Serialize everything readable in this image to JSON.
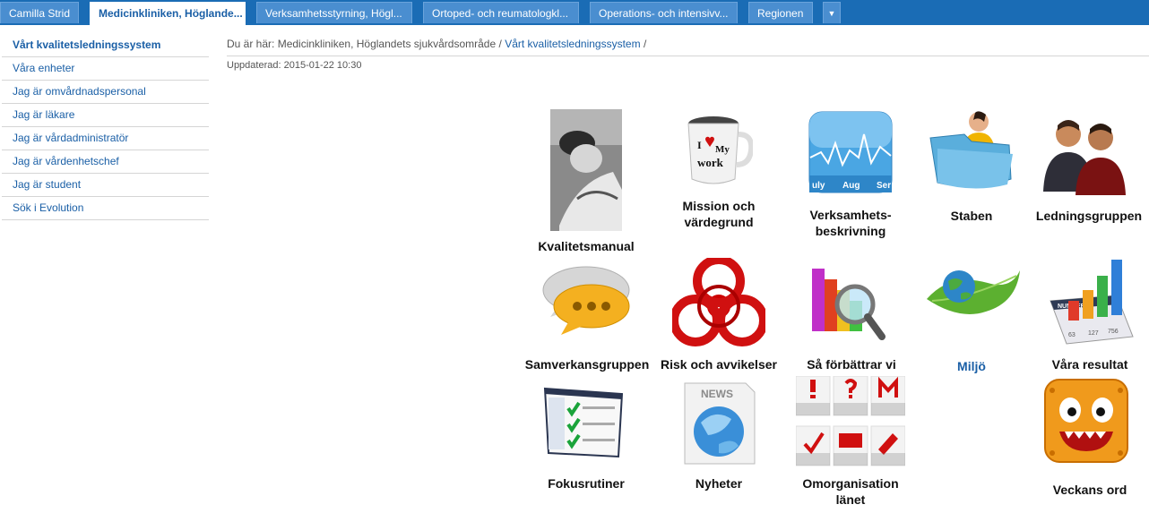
{
  "tabs": [
    {
      "label": "Camilla Strid"
    },
    {
      "label": "Medicinkliniken, Höglande..."
    },
    {
      "label": "Verksamhetsstyrning, Högl..."
    },
    {
      "label": "Ortoped- och reumatologkl..."
    },
    {
      "label": "Operations- och intensivv..."
    },
    {
      "label": "Regionen"
    }
  ],
  "sidebar": {
    "items": [
      {
        "label": "Vårt kvalitetsledningssystem"
      },
      {
        "label": "Våra enheter"
      },
      {
        "label": "Jag är omvårdnadspersonal"
      },
      {
        "label": "Jag är läkare"
      },
      {
        "label": "Jag är vårdadministratör"
      },
      {
        "label": "Jag är vårdenhetschef"
      },
      {
        "label": "Jag är student"
      },
      {
        "label": "Sök i Evolution"
      }
    ]
  },
  "breadcrumb": {
    "prefix": "Du är här:",
    "parent": "Medicinkliniken, Höglandets sjukvårdsområde",
    "sep": "/",
    "current": "Vårt kvalitetsledningssystem",
    "sep2": "/"
  },
  "updated": "Uppdaterad: 2015-01-22 10:30",
  "tiles": [
    {
      "l1": "Kvalitetsmanual",
      "l2": ""
    },
    {
      "l1": "Mission och",
      "l2": "värdegrund"
    },
    {
      "l1": "Verksamhets-",
      "l2": "beskrivning"
    },
    {
      "l1": "Staben",
      "l2": ""
    },
    {
      "l1": "Ledningsgruppen",
      "l2": ""
    },
    {
      "l1": "Samverkansgruppen",
      "l2": ""
    },
    {
      "l1": "Risk och avvikelser",
      "l2": ""
    },
    {
      "l1": "Så förbättrar vi",
      "l2": ""
    },
    {
      "l1": "Miljö",
      "l2": ""
    },
    {
      "l1": "Våra resultat",
      "l2": ""
    },
    {
      "l1": "Fokusrutiner",
      "l2": ""
    },
    {
      "l1": "Nyheter",
      "l2": ""
    },
    {
      "l1": "Omorganisation",
      "l2": "länet"
    },
    {
      "l1": "Veckans ord",
      "l2": ""
    }
  ],
  "icon_text": {
    "mug_line1": "I",
    "mug_line2": "My",
    "mug_line3": "work",
    "graph_months": [
      "uly",
      "Aug",
      "Ser"
    ],
    "news": "NEWS",
    "numbers": "NUMBERS",
    "nums": [
      "63",
      "127",
      "756"
    ]
  }
}
